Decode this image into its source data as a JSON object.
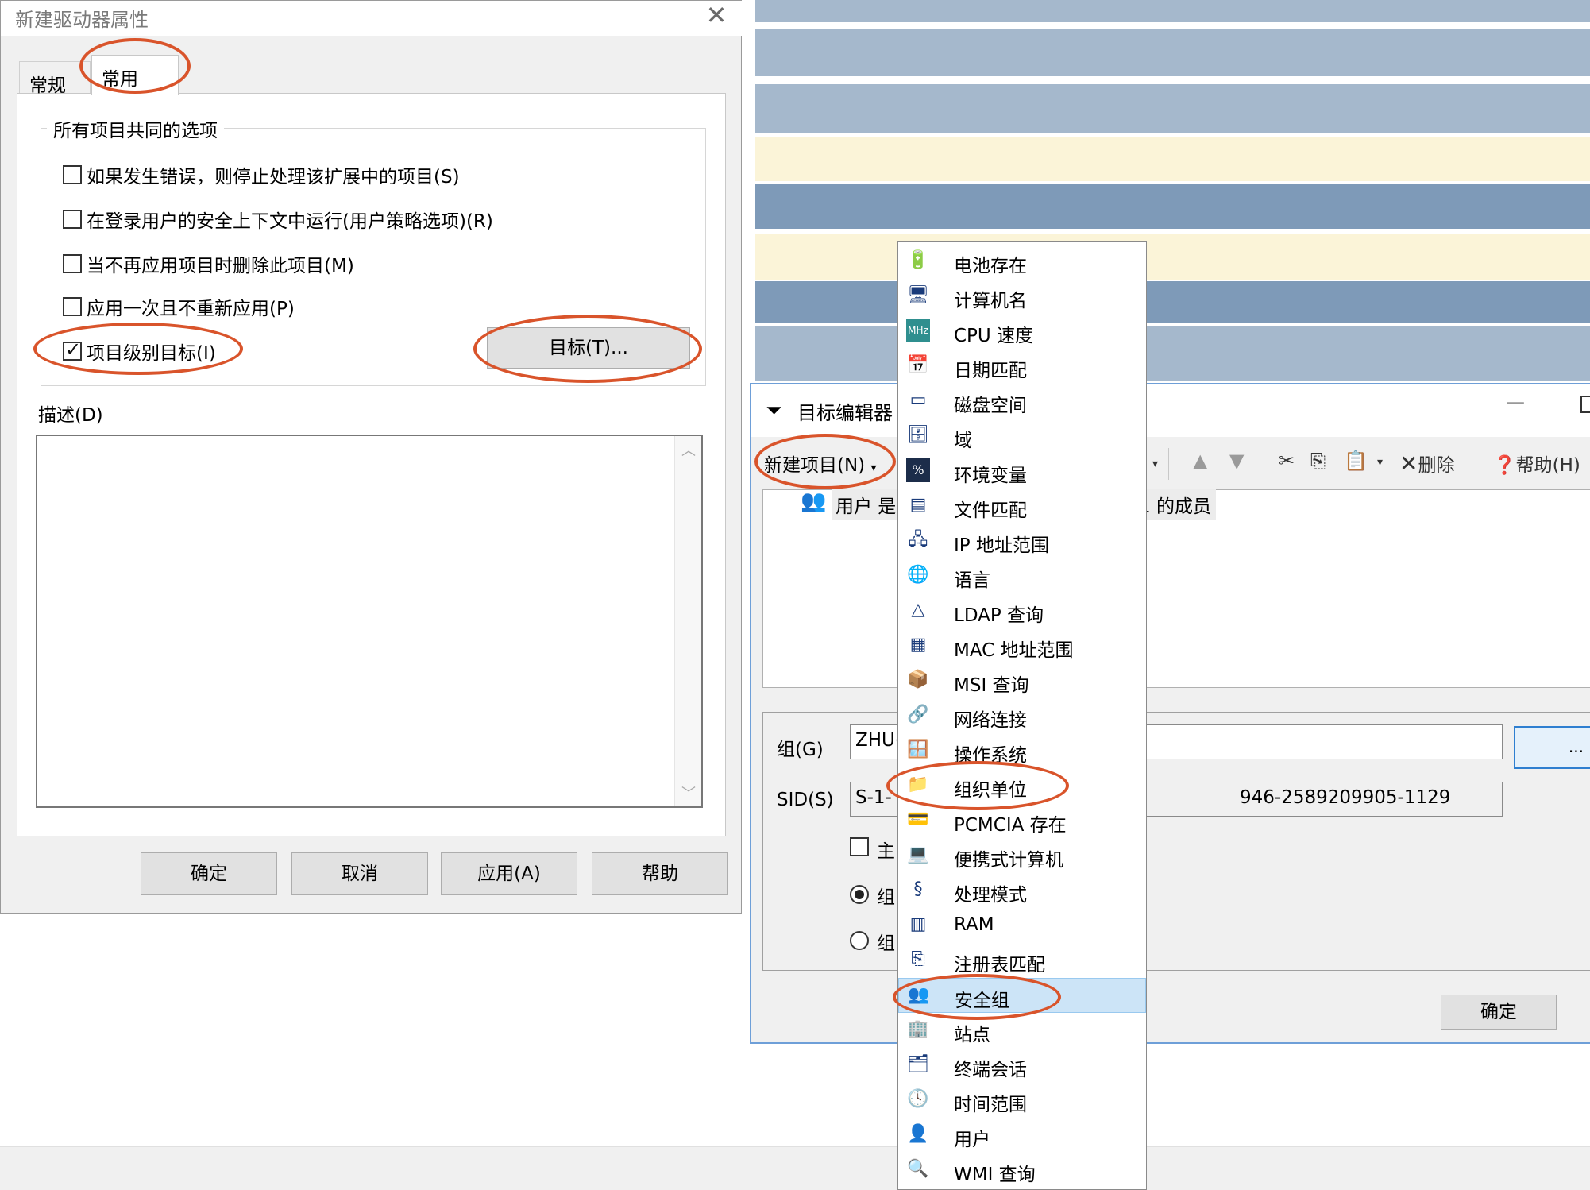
{
  "left_dialog": {
    "title": "新建驱动器属性",
    "close": "✕",
    "tabs": [
      {
        "label": "常规"
      },
      {
        "label": "常用"
      }
    ],
    "group_title": "所有项目共同的选项",
    "options": [
      {
        "label": "如果发生错误，则停止处理该扩展中的项目(S)",
        "checked": false
      },
      {
        "label": "在登录用户的安全上下文中运行(用户策略选项)(R)",
        "checked": false
      },
      {
        "label": "当不再应用项目时删除此项目(M)",
        "checked": false
      },
      {
        "label": "应用一次且不重新应用(P)",
        "checked": false
      },
      {
        "label": "项目级别目标(I)",
        "checked": true
      }
    ],
    "target_button": "目标(T)...",
    "description_label": "描述(D)",
    "buttons": {
      "ok": "确定",
      "cancel": "取消",
      "apply": "应用(A)",
      "help": "帮助"
    }
  },
  "target_editor": {
    "title": "目标编辑器",
    "minimize": "—",
    "toolbar": {
      "new_item": "新建项目(N)",
      "dropdown_fragment": ")",
      "delete": "删除",
      "help": "帮助(H)"
    },
    "list_row_left": "用户 是",
    "list_row_right": "1 的成员",
    "group_label": "组(G)",
    "group_value": "ZHU(",
    "browse_label": "...",
    "sid_label": "SID(S)",
    "sid_value_left": "S-1-",
    "sid_value_right": "946-2589209905-1129",
    "primary_fragment": "主",
    "radio_1_fragment": "组",
    "radio_2_fragment": "组",
    "ok": "确定"
  },
  "menu": {
    "items": [
      {
        "label": "电池存在",
        "icon": "battery-icon",
        "glyph": "🔋"
      },
      {
        "label": "计算机名",
        "icon": "computer-icon",
        "glyph": "🖥"
      },
      {
        "label": "CPU 速度",
        "icon": "cpu-mhz-icon",
        "glyph": "MHz"
      },
      {
        "label": "日期匹配",
        "icon": "calendar-icon",
        "glyph": "📅"
      },
      {
        "label": "磁盘空间",
        "icon": "disk-icon",
        "glyph": "▭"
      },
      {
        "label": "域",
        "icon": "domain-icon",
        "glyph": "🗄"
      },
      {
        "label": "环境变量",
        "icon": "env-var-icon",
        "glyph": "%"
      },
      {
        "label": "文件匹配",
        "icon": "file-window-icon",
        "glyph": "▤"
      },
      {
        "label": "IP 地址范围",
        "icon": "ip-network-icon",
        "glyph": "🖧"
      },
      {
        "label": "语言",
        "icon": "globe-icon",
        "glyph": "🌐"
      },
      {
        "label": "LDAP 查询",
        "icon": "ldap-icon",
        "glyph": "△"
      },
      {
        "label": "MAC 地址范围",
        "icon": "network-card-icon",
        "glyph": "▦"
      },
      {
        "label": "MSI 查询",
        "icon": "msi-icon",
        "glyph": "📦"
      },
      {
        "label": "网络连接",
        "icon": "network-connection-icon",
        "glyph": "🔗"
      },
      {
        "label": "操作系统",
        "icon": "os-icon",
        "glyph": "🪟"
      },
      {
        "label": "组织单位",
        "icon": "ou-icon",
        "glyph": "📁"
      },
      {
        "label": "PCMCIA 存在",
        "icon": "pcmcia-icon",
        "glyph": "💳"
      },
      {
        "label": "便携式计算机",
        "icon": "laptop-icon",
        "glyph": "💻"
      },
      {
        "label": "处理模式",
        "icon": "processing-mode-icon",
        "glyph": "§"
      },
      {
        "label": "RAM",
        "icon": "ram-icon",
        "glyph": "▥"
      },
      {
        "label": "注册表匹配",
        "icon": "registry-icon",
        "glyph": "⎘"
      },
      {
        "label": "安全组",
        "icon": "security-group-icon",
        "glyph": "👥"
      },
      {
        "label": "站点",
        "icon": "site-icon",
        "glyph": "🏢"
      },
      {
        "label": "终端会话",
        "icon": "terminal-session-icon",
        "glyph": "🗂"
      },
      {
        "label": "时间范围",
        "icon": "clock-icon",
        "glyph": "🕓"
      },
      {
        "label": "用户",
        "icon": "user-icon",
        "glyph": "👤"
      },
      {
        "label": "WMI 查询",
        "icon": "wmi-icon",
        "glyph": "🔍"
      }
    ],
    "selected_index": 21
  },
  "colors": {
    "annotation": "#d9542b",
    "selection": "#cce4f7",
    "stripe_blue_light": "#a5b8cc",
    "stripe_blue_dark": "#7e9ab8",
    "stripe_cream": "#fbf4d8"
  }
}
